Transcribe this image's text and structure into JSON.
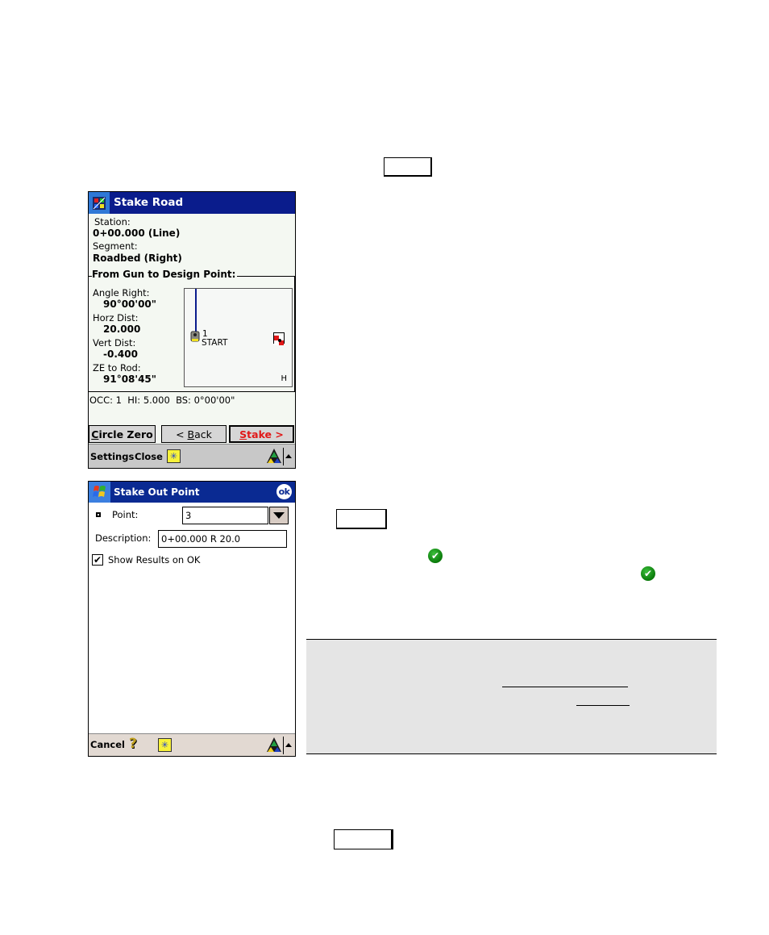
{
  "document": {
    "key_placeholders": [
      "",
      "",
      ""
    ],
    "note_panel": {
      "links": [
        "",
        ""
      ]
    }
  },
  "stake_road": {
    "title": "Stake Road",
    "station_label": "Station:",
    "station_value": "0+00.000 (Line)",
    "segment_label": "Segment:",
    "segment_value": "Roadbed (Right)",
    "group_title": "From Gun to Design Point:",
    "angle_right_label": "Angle Right:",
    "angle_right_value": "90°00'00\"",
    "horz_dist_label": "Horz Dist:",
    "horz_dist_value": "20.000",
    "vert_dist_label": "Vert Dist:",
    "vert_dist_value": "-0.400",
    "ze_to_rod_label": "ZE to Rod:",
    "ze_to_rod_value": "91°08'45\"",
    "plot": {
      "point_number": "1",
      "point_label": "START",
      "mode_label": "H",
      "line_color": "#0a1c8c",
      "target_color": "#e01818"
    },
    "status_line": "OCC: 1  HI: 5.000  BS: 0°00'00\"",
    "buttons": {
      "circle_zero": {
        "mnemonic": "C",
        "rest": "ircle Zero"
      },
      "back": {
        "prefix": "< ",
        "mnemonic": "B",
        "rest": "ack"
      },
      "stake": {
        "mnemonic": "S",
        "rest": "take >"
      }
    },
    "command_bar": {
      "settings": "Settings",
      "close": "Close"
    },
    "accent": "#0a1c8c",
    "stake_color": "#e01818"
  },
  "stake_out_point": {
    "title": "Stake Out Point",
    "ok_label": "ok",
    "point_label": "Point:",
    "point_value": "3",
    "description_label": "Description:",
    "description_value": "0+00.000 R 20.0",
    "show_results_label": "Show Results on OK",
    "show_results_checked": true,
    "command_bar": {
      "cancel": "Cancel",
      "help_glyph": "?"
    }
  },
  "icons": {
    "check": "✔",
    "star": "✳"
  }
}
